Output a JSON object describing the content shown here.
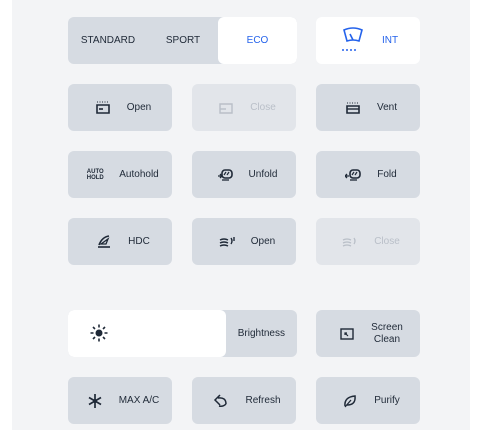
{
  "drive_modes": {
    "options": [
      "STANDARD",
      "SPORT",
      "ECO"
    ],
    "selected": "ECO"
  },
  "wiper": {
    "label": "INT",
    "icon": "wiper-icon"
  },
  "rows": {
    "trunk_open": {
      "label": "Open",
      "icon": "trunk-open-icon"
    },
    "trunk_close": {
      "label": "Close",
      "icon": "trunk-close-icon",
      "disabled": true
    },
    "vent": {
      "label": "Vent",
      "icon": "vent-icon"
    },
    "autohold": {
      "label": "Autohold",
      "icon": "autohold-icon",
      "icon_text_top": "AUTO",
      "icon_text_bottom": "HOLD"
    },
    "mirror_unfold": {
      "label": "Unfold",
      "icon": "mirror-unfold-icon"
    },
    "mirror_fold": {
      "label": "Fold",
      "icon": "mirror-fold-icon"
    },
    "hdc": {
      "label": "HDC",
      "icon": "hdc-icon"
    },
    "window_open": {
      "label": "Open",
      "icon": "window-open-icon"
    },
    "window_close": {
      "label": "Close",
      "icon": "window-close-icon",
      "disabled": true
    }
  },
  "brightness": {
    "label": "Brightness",
    "level": 0.69,
    "icon": "sun-icon"
  },
  "screen_clean": {
    "line1": "Screen",
    "line2": "Clean",
    "icon": "screen-clean-icon"
  },
  "bottom": {
    "max_ac": {
      "label": "MAX A/C",
      "icon": "snowflake-icon"
    },
    "refresh": {
      "label": "Refresh",
      "icon": "refresh-icon"
    },
    "purify": {
      "label": "Purify",
      "icon": "leaf-icon"
    }
  },
  "colors": {
    "accent": "#2563eb",
    "button_bg": "#d6dbe2",
    "panel_bg": "#f3f4f6",
    "disabled_text": "#b9bfc8"
  }
}
